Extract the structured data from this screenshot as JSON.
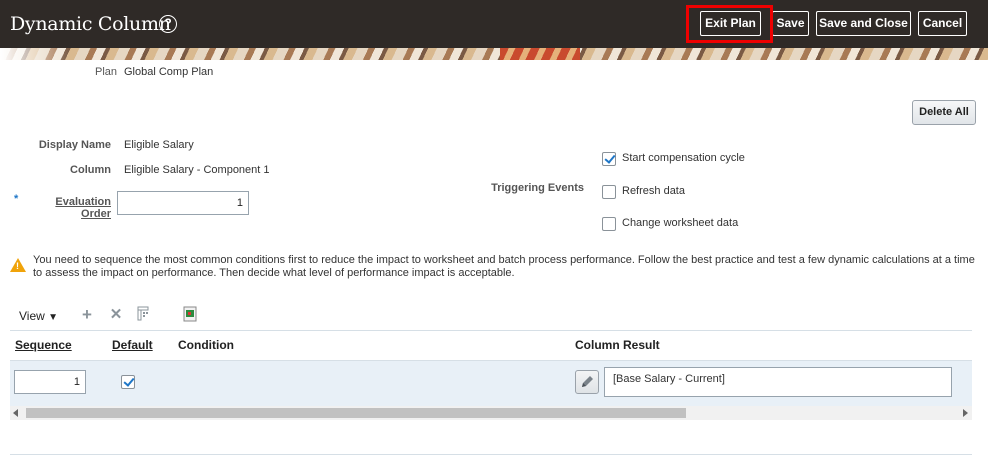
{
  "header": {
    "title": "Dynamic Column",
    "exit_plan_label": "Exit Plan",
    "save_label": "Save",
    "save_close_label": "Save and Close",
    "cancel_label": "Cancel"
  },
  "plan": {
    "label": "Plan",
    "value": "Global Comp Plan"
  },
  "actions": {
    "delete_all_label": "Delete All"
  },
  "form": {
    "display_name_label": "Display Name",
    "display_name_value": "Eligible Salary",
    "column_label": "Column",
    "column_value": "Eligible Salary - Component 1",
    "required_marker": "*",
    "evaluation_order_label": "Evaluation Order",
    "evaluation_order_value": "1",
    "triggering_events_label": "Triggering Events",
    "events": [
      {
        "label": "Start compensation cycle",
        "checked": true
      },
      {
        "label": "Refresh data",
        "checked": false
      },
      {
        "label": "Change worksheet data",
        "checked": false
      }
    ]
  },
  "warning": {
    "text": "You need to sequence the most common conditions first to reduce the impact to worksheet and batch process performance. Follow the best practice and test a few dynamic calculations at a time to assess the impact on performance. Then decide what level of performance impact is acceptable."
  },
  "table": {
    "view_label": "View",
    "columns": [
      "Sequence",
      "Default",
      "Condition",
      "Column Result"
    ],
    "rows": [
      {
        "sequence": "1",
        "default": true,
        "condition": "",
        "column_result": "[Base Salary - Current]"
      }
    ]
  }
}
